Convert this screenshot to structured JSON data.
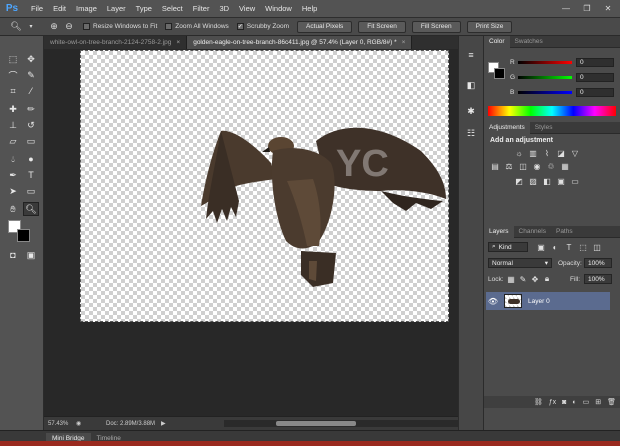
{
  "app": {
    "logo": "Ps",
    "menu": [
      "File",
      "Edit",
      "Image",
      "Layer",
      "Type",
      "Select",
      "Filter",
      "3D",
      "View",
      "Window",
      "Help"
    ]
  },
  "options_bar": {
    "resize_windows_label": "Resize Windows to Fit",
    "zoom_all_label": "Zoom All Windows",
    "scrubby_zoom_label": "Scrubby Zoom",
    "scrubby_zoom_checked": "✓",
    "actual_pixels": "Actual Pixels",
    "fit_screen": "Fit Screen",
    "fill_screen": "Fill Screen",
    "print_size": "Print Size"
  },
  "document": {
    "tabs": [
      {
        "label": "white-owl-on-tree-branch-2124-2758-2.jpg",
        "active": false
      },
      {
        "label": "golden-eagle-on-tree-branch-86c411.jpg @ 57.4% (Layer 0, RGB/8#) *",
        "active": true
      }
    ],
    "tab_close": "×",
    "zoom": "57.43%",
    "doc_size": "Doc: 2.89M/3.88M",
    "arrow": "▶"
  },
  "color_panel": {
    "tabs": [
      "Color",
      "Swatches"
    ],
    "channels": [
      {
        "label": "R",
        "value": "0"
      },
      {
        "label": "G",
        "value": "0"
      },
      {
        "label": "B",
        "value": "0"
      }
    ]
  },
  "adjustments_panel": {
    "tabs": [
      "Adjustments",
      "Styles"
    ],
    "heading": "Add an adjustment"
  },
  "layers_panel": {
    "tabs": [
      "Layers",
      "Channels",
      "Paths"
    ],
    "kind": "Kind",
    "blend_mode": "Normal",
    "opacity_label": "Opacity:",
    "opacity_value": "100%",
    "lock_label": "Lock:",
    "fill_label": "Fill:",
    "fill_value": "100%",
    "layer_name": "Layer 0"
  },
  "bottom_tabs": [
    "Mini Bridge",
    "Timeline"
  ],
  "colors": {
    "accent": "#4da6ff",
    "selected_layer": "#5b6b8f"
  }
}
